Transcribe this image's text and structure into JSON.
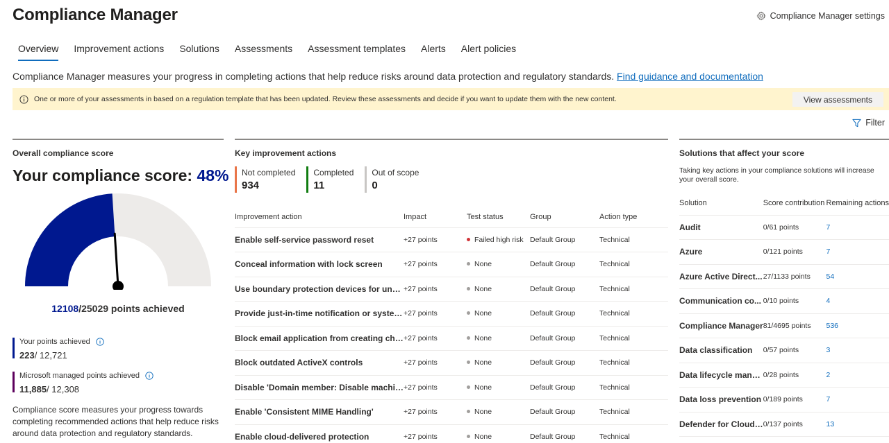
{
  "header": {
    "title": "Compliance Manager",
    "settings_label": "Compliance Manager settings"
  },
  "tabs": [
    {
      "label": "Overview",
      "active": true
    },
    {
      "label": "Improvement actions"
    },
    {
      "label": "Solutions"
    },
    {
      "label": "Assessments"
    },
    {
      "label": "Assessment templates"
    },
    {
      "label": "Alerts"
    },
    {
      "label": "Alert policies"
    }
  ],
  "intro": {
    "text": "Compliance Manager measures your progress in completing actions that help reduce risks around data protection and regulatory standards.",
    "link": "Find guidance and documentation"
  },
  "banner": {
    "text": "One or more of your assessments in based on a regulation template that has been updated. Review these assessments and decide if you want to update them with the new content.",
    "button": "View assessments",
    "bg_color": "#fff4ce"
  },
  "filter_label": "Filter",
  "score_panel": {
    "title": "Overall compliance score",
    "score_label": "Your compliance score:",
    "score_pct": "48%",
    "score_fraction": 0.48,
    "points_mine": "12108",
    "points_rest": "/25029 points achieved",
    "your_points_label": "Your points achieved",
    "your_points_value": "223",
    "your_points_total": "/ 12,721",
    "ms_points_label": "Microsoft managed points achieved",
    "ms_points_value": "11,885",
    "ms_points_total": "/ 12,308",
    "description": "Compliance score measures your progress towards completing recommended actions that help reduce risks around data protection and regulatory standards.",
    "colors": {
      "achieved": "#00188f",
      "remaining": "#edebe9",
      "your_bar": "#00188f",
      "ms_bar": "#5c005c"
    }
  },
  "actions_panel": {
    "title": "Key improvement actions",
    "kpis": [
      {
        "label": "Not completed",
        "value": "934",
        "color": "#e97548"
      },
      {
        "label": "Completed",
        "value": "11",
        "color": "#107c10"
      },
      {
        "label": "Out of scope",
        "value": "0",
        "color": "#c8c6c4"
      }
    ],
    "columns": [
      "Improvement action",
      "Impact",
      "Test status",
      "Group",
      "Action type"
    ],
    "rows": [
      {
        "name": "Enable self-service password reset",
        "impact": "+27 points",
        "status": "Failed high risk",
        "status_color": "#d13438",
        "group": "Default Group",
        "type": "Technical"
      },
      {
        "name": "Conceal information with lock screen",
        "impact": "+27 points",
        "status": "None",
        "status_color": "#a19f9d",
        "group": "Default Group",
        "type": "Technical"
      },
      {
        "name": "Use boundary protection devices for unclas...",
        "impact": "+27 points",
        "status": "None",
        "status_color": "#a19f9d",
        "group": "Default Group",
        "type": "Technical"
      },
      {
        "name": "Provide just-in-time notification or system ...",
        "impact": "+27 points",
        "status": "None",
        "status_color": "#a19f9d",
        "group": "Default Group",
        "type": "Technical"
      },
      {
        "name": "Block email application from creating child ...",
        "impact": "+27 points",
        "status": "None",
        "status_color": "#a19f9d",
        "group": "Default Group",
        "type": "Technical"
      },
      {
        "name": "Block outdated ActiveX controls",
        "impact": "+27 points",
        "status": "None",
        "status_color": "#a19f9d",
        "group": "Default Group",
        "type": "Technical"
      },
      {
        "name": "Disable 'Domain member: Disable machine...",
        "impact": "+27 points",
        "status": "None",
        "status_color": "#a19f9d",
        "group": "Default Group",
        "type": "Technical"
      },
      {
        "name": "Enable 'Consistent MIME Handling'",
        "impact": "+27 points",
        "status": "None",
        "status_color": "#a19f9d",
        "group": "Default Group",
        "type": "Technical"
      },
      {
        "name": "Enable cloud-delivered protection",
        "impact": "+27 points",
        "status": "None",
        "status_color": "#a19f9d",
        "group": "Default Group",
        "type": "Technical"
      }
    ]
  },
  "solutions_panel": {
    "title": "Solutions that affect your score",
    "subtitle": "Taking key actions in your compliance solutions will increase your overall score.",
    "columns": [
      "Solution",
      "Score contribution",
      "Remaining actions"
    ],
    "rows": [
      {
        "name": "Audit",
        "contribution": "0/61 points",
        "remaining": "7"
      },
      {
        "name": "Azure",
        "contribution": "0/121 points",
        "remaining": "7"
      },
      {
        "name": "Azure Active Direct...",
        "contribution": "27/1133 points",
        "remaining": "54"
      },
      {
        "name": "Communication co...",
        "contribution": "0/10 points",
        "remaining": "4"
      },
      {
        "name": "Compliance Manager",
        "contribution": "81/4695 points",
        "remaining": "536"
      },
      {
        "name": "Data classification",
        "contribution": "0/57 points",
        "remaining": "3"
      },
      {
        "name": "Data lifecycle mana...",
        "contribution": "0/28 points",
        "remaining": "2"
      },
      {
        "name": "Data loss prevention",
        "contribution": "0/189 points",
        "remaining": "7"
      },
      {
        "name": "Defender for Cloud ...",
        "contribution": "0/137 points",
        "remaining": "13"
      }
    ]
  }
}
